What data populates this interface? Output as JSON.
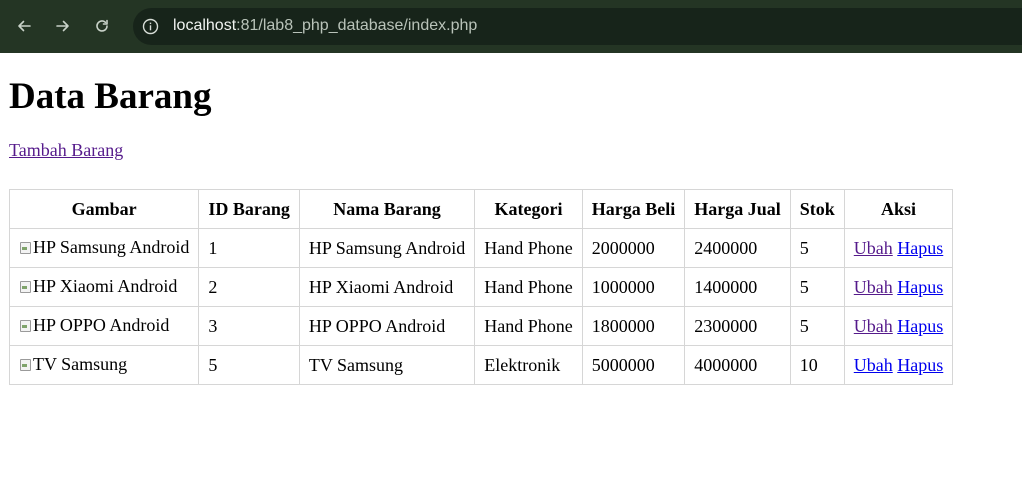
{
  "browser": {
    "url_host": "localhost",
    "url_rest": ":81/lab8_php_database/index.php",
    "back_icon": "arrow-left-icon",
    "forward_icon": "arrow-right-icon",
    "reload_icon": "reload-icon",
    "site_info_icon": "info-icon"
  },
  "page": {
    "title": "Data Barang",
    "add_link": "Tambah Barang"
  },
  "table": {
    "headers": [
      "Gambar",
      "ID Barang",
      "Nama Barang",
      "Kategori",
      "Harga Beli",
      "Harga Jual",
      "Stok",
      "Aksi"
    ],
    "rows": [
      {
        "img_alt": "HP Samsung Android",
        "id": "1",
        "nama": "HP Samsung Android",
        "kategori": "Hand Phone",
        "harga_beli": "2000000",
        "harga_jual": "2400000",
        "stok": "5",
        "ubah": "Ubah",
        "hapus": "Hapus"
      },
      {
        "img_alt": "HP Xiaomi Android",
        "id": "2",
        "nama": "HP Xiaomi Android",
        "kategori": "Hand Phone",
        "harga_beli": "1000000",
        "harga_jual": "1400000",
        "stok": "5",
        "ubah": "Ubah",
        "hapus": "Hapus"
      },
      {
        "img_alt": "HP OPPO Android",
        "id": "3",
        "nama": "HP OPPO Android",
        "kategori": "Hand Phone",
        "harga_beli": "1800000",
        "harga_jual": "2300000",
        "stok": "5",
        "ubah": "Ubah",
        "hapus": "Hapus"
      },
      {
        "img_alt": "TV Samsung",
        "id": "5",
        "nama": "TV Samsung",
        "kategori": "Elektronik",
        "harga_beli": "5000000",
        "harga_jual": "4000000",
        "stok": "10",
        "ubah": "Ubah",
        "hapus": "Hapus"
      }
    ]
  },
  "colors": {
    "chrome_bg": "#243524",
    "omnibox_bg": "#17241a",
    "link_unvisited": "#0000ee",
    "link_visited": "#551a8b",
    "table_border": "#d6d6d6"
  }
}
